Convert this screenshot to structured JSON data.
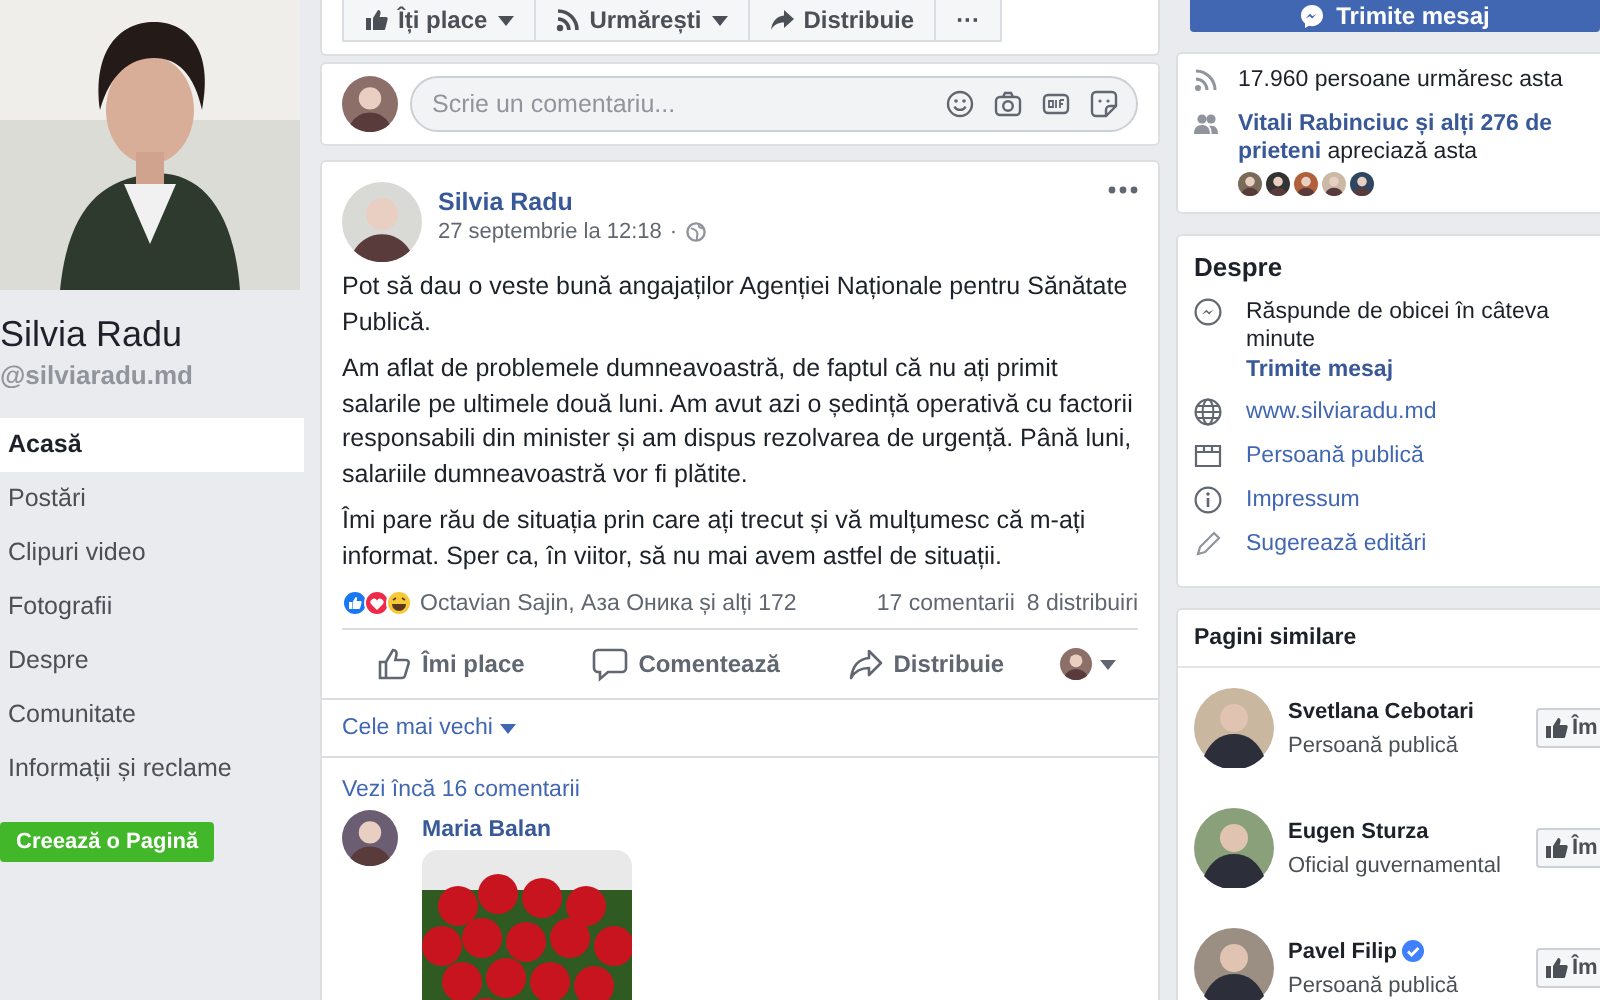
{
  "page_actions": [
    {
      "label": "Îți place",
      "kind": "like",
      "dropdown": true
    },
    {
      "label": "Urmărești",
      "kind": "follow",
      "dropdown": true
    },
    {
      "label": "Distribuie",
      "kind": "share",
      "dropdown": false
    },
    {
      "label": "···",
      "kind": "more",
      "dropdown": false
    }
  ],
  "message_button": {
    "label": "Trimite mesaj"
  },
  "profile": {
    "name": "Silvia Radu",
    "handle": "@silviaradu.md"
  },
  "nav": [
    {
      "label": "Acasă",
      "selected": true
    },
    {
      "label": "Postări",
      "selected": false
    },
    {
      "label": "Clipuri video",
      "selected": false
    },
    {
      "label": "Fotografii",
      "selected": false
    },
    {
      "label": "Despre",
      "selected": false
    },
    {
      "label": "Comunitate",
      "selected": false
    },
    {
      "label": "Informații și reclame",
      "selected": false
    }
  ],
  "create_page_button": {
    "label": "Creează o Pagină"
  },
  "comment_box": {
    "placeholder": "Scrie un comentariu..."
  },
  "post": {
    "author": "Silvia Radu",
    "time": "27 septembrie la 12:18",
    "separator": "·",
    "paragraphs": [
      "Pot să dau o veste bună angajaților Agenției Naționale pentru Sănătate Publică.",
      "Am aflat de problemele dumneavoastră, de faptul că nu ați primit salarile pe ultimele două luni. Am avut azi o ședință operativă cu factorii responsabili din minister și am dispus rezolvarea de urgență. Până luni, salariile dumneavoastră vor fi plătite.",
      "Îmi pare rău de situația prin care ați trecut și vă mulțumesc că m-ați informat. Sper ca, în viitor, să nu mai avem astfel de situații."
    ],
    "reactions": "Octavian Sajin, Аза Оника și alți 172",
    "comments_count": "17 comentarii",
    "shares_count": "8 distribuiri",
    "actions": [
      {
        "label": "Îmi place",
        "kind": "like"
      },
      {
        "label": "Comentează",
        "kind": "comment"
      },
      {
        "label": "Distribuie",
        "kind": "share"
      }
    ],
    "sort": "Cele mai vechi",
    "more_comments": "Vezi încă 16 comentarii",
    "comments": [
      {
        "author": "Maria Balan"
      }
    ]
  },
  "stats": [
    {
      "kind": "followers",
      "text": "17.960 persoane urmăresc asta"
    },
    {
      "kind": "friends",
      "text": "**Vitali Rabinciuc și alți 276 de prieteni** apreciază asta"
    }
  ],
  "about": {
    "title": "Despre",
    "items": [
      {
        "kind": "messenger",
        "text": "Răspunde de obicei în câteva minute",
        "link": "Trimite mesaj"
      },
      {
        "kind": "website",
        "text": "www.silviaradu.md"
      },
      {
        "kind": "category",
        "text": "Persoană publică"
      },
      {
        "kind": "info",
        "text": "Impressum"
      },
      {
        "kind": "edit",
        "text": "Sugerează editări"
      }
    ]
  },
  "similar_pages": {
    "title": "Pagini similare",
    "items": [
      {
        "name": "Svetlana Cebotari",
        "category": "Persoană publică",
        "verified": false,
        "button": "Îm"
      },
      {
        "name": "Eugen Sturza",
        "category": "Oficial guvernamental",
        "verified": false,
        "button": "Îm"
      },
      {
        "name": "Pavel Filip",
        "category": "Persoană publică",
        "verified": true,
        "button": "Îm"
      }
    ]
  }
}
